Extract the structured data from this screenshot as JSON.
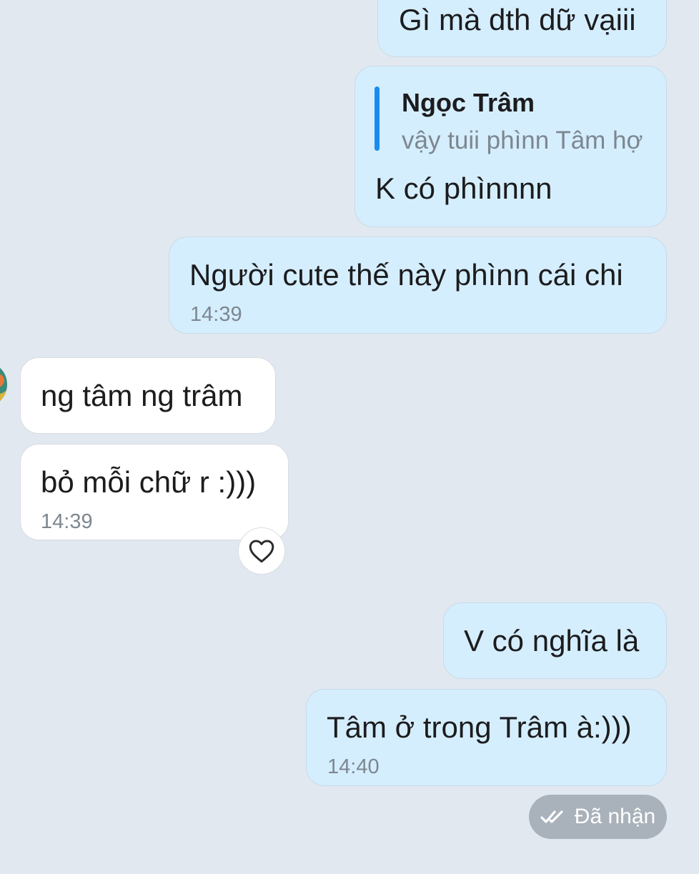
{
  "messages": [
    {
      "direction": "out",
      "text": "Gì mà dth dữ vạiii"
    },
    {
      "direction": "out",
      "reply_to": {
        "name": "Ngọc Trâm",
        "text": "vậy tuii phìnn Tâm hợ"
      },
      "text": "K có phìnnnn"
    },
    {
      "direction": "out",
      "text": "Người cute thế này phìnn cái chi",
      "time": "14:39"
    },
    {
      "direction": "in",
      "text": "ng tâm ng trâm"
    },
    {
      "direction": "in",
      "text": "bỏ mỗi chữ r :)))",
      "time": "14:39",
      "reaction_icon": "heart-outline-icon"
    },
    {
      "direction": "out",
      "text": "V có nghĩa là"
    },
    {
      "direction": "out",
      "text": "Tâm ở trong Trâm à:)))",
      "time": "14:40"
    }
  ],
  "status": {
    "label": "Đã nhận",
    "icon": "double-check-icon"
  }
}
